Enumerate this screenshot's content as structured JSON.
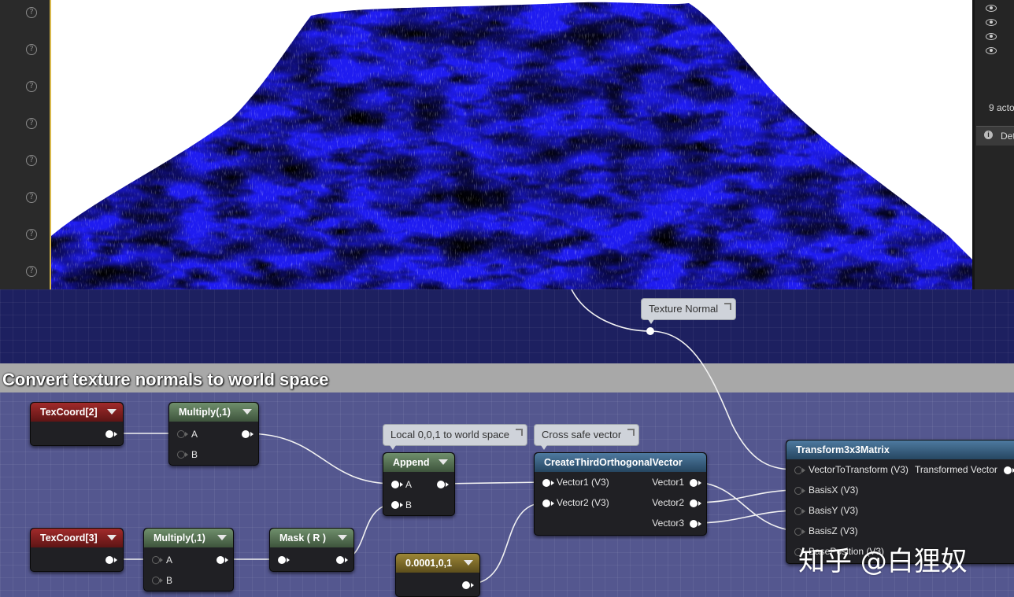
{
  "viewport": {
    "toolbar_icon": "help-icon",
    "toolbar_icon_glyph": "?",
    "toolbar_icon_count": 8
  },
  "outliner": {
    "visibility_icon": "eye-icon",
    "visible_row_count": 4,
    "actor_count_text": "9 acto",
    "details_tab_label": "Det"
  },
  "graph": {
    "comment_title": "Convert texture normals to world space",
    "tooltips": {
      "texture_normal": "Texture Normal",
      "local_to_world": "Local 0,0,1 to world space",
      "cross_safe": "Cross safe vector"
    },
    "nodes": {
      "texcoord2": {
        "title": "TexCoord[2]"
      },
      "multiply1": {
        "title": "Multiply(,1)",
        "pins": [
          "A",
          "B"
        ]
      },
      "texcoord3": {
        "title": "TexCoord[3]"
      },
      "multiply2": {
        "title": "Multiply(,1)",
        "pins": [
          "A",
          "B"
        ]
      },
      "mask": {
        "title": "Mask ( R )"
      },
      "append": {
        "title": "Append",
        "pins": [
          "A",
          "B"
        ]
      },
      "constant": {
        "title": "0.0001,0,1"
      },
      "create_third": {
        "title": "CreateThirdOrthogonalVector",
        "inputs": [
          "Vector1 (V3)",
          "Vector2 (V3)"
        ],
        "outputs": [
          "Vector1",
          "Vector2",
          "Vector3"
        ]
      },
      "transform": {
        "title": "Transform3x3Matrix",
        "inputs": [
          "VectorToTransform (V3)",
          "BasisX (V3)",
          "BasisY (V3)",
          "BasisZ (V3)",
          "BasePosition (V3)"
        ],
        "output": "Transformed Vector"
      }
    },
    "colors": {
      "comment_bg": "#54578f",
      "graph_bg": "#1d2060",
      "texcoord_header": "#8b2222",
      "math_header": "#5b7a59",
      "constant_header": "#8a7430",
      "function_header": "#3e6a8f"
    }
  },
  "watermark": "知乎 @白狸奴"
}
